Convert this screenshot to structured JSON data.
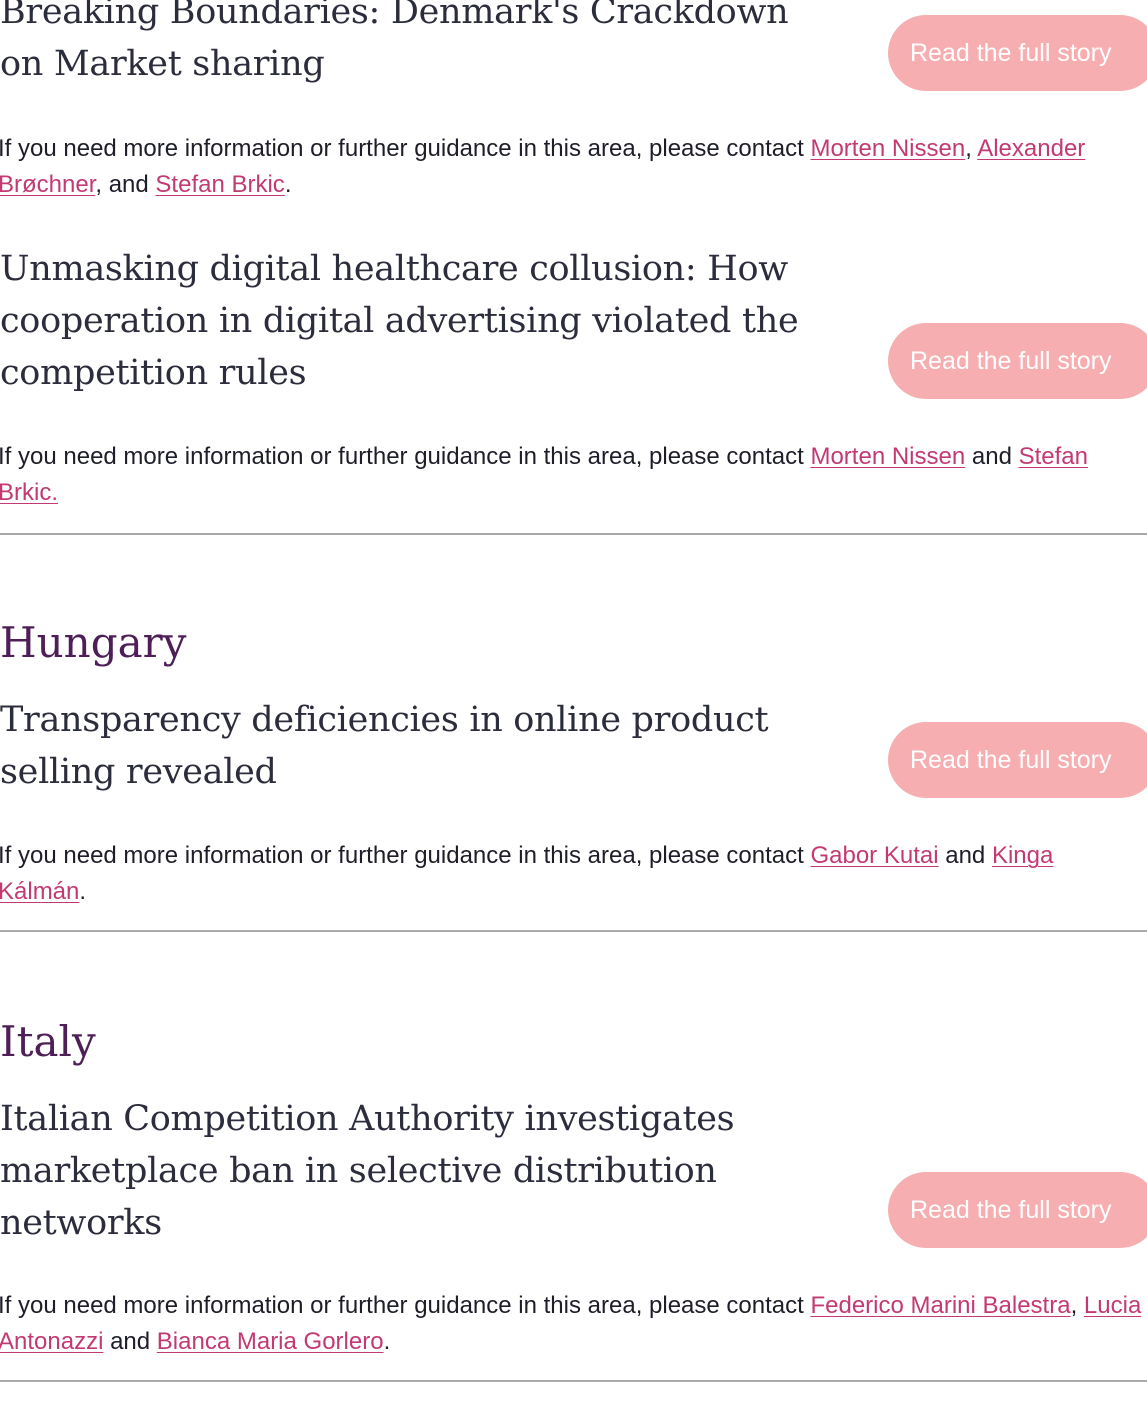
{
  "intro": "If you need more information or further guidance in this area, please contact ",
  "cta_label": "Read the full story",
  "denmark": {
    "story1": {
      "title": "Breaking Boundaries: Denmark's Crackdown on Market sharing",
      "contacts": [
        "Morten Nissen",
        "Alexander Brøchner",
        "Stefan Brkic"
      ],
      "sep1": ", ",
      "sep2": ", and ",
      "end": "."
    },
    "story2": {
      "title": "Unmasking digital healthcare collusion: How cooperation in digital advertising violated the competition rules",
      "contacts": [
        "Morten Nissen",
        "Stefan Brkic."
      ],
      "sep1": " and "
    }
  },
  "hungary": {
    "heading": "Hungary",
    "story1": {
      "title": "Transparency deficiencies in online product selling revealed",
      "contacts": [
        "Gabor Kutai",
        "Kinga Kálmán"
      ],
      "sep1": " and ",
      "end": "."
    }
  },
  "italy": {
    "heading": "Italy",
    "story1": {
      "title": "Italian Competition Authority investigates marketplace ban in selective distribution networks",
      "contacts": [
        "Federico Marini Balestra",
        "Lucia Antonazzi",
        "Bianca Maria Gorlero"
      ],
      "sep1": ", ",
      "sep2": " and ",
      "end": "."
    }
  },
  "colors": {
    "country_heading": "#4e1e57",
    "headline": "#2c2d3c",
    "link": "#c33a73",
    "button_bg": "#f7aeb1",
    "button_text": "#ffffff",
    "divider": "#a9a9ad"
  }
}
